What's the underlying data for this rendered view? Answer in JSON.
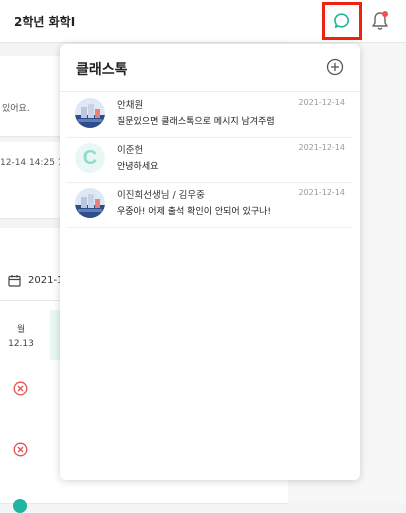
{
  "header": {
    "title": "2학년 화학I"
  },
  "background": {
    "notice_text": "있어요.",
    "timestamp": "12-14 14:25 1",
    "date_range": "2021-1",
    "day_name": "월",
    "day_date": "12.13"
  },
  "chat_popup": {
    "title": "클래스톡",
    "messages": [
      {
        "name": "안채원",
        "time": "2021-12-14",
        "text": "질문있으면 클래스톡으로 메시지 남겨주렴"
      },
      {
        "name": "이준헌",
        "time": "2021-12-14",
        "text": "안녕하세요",
        "avatar_letter": "C"
      },
      {
        "name": "이진희선생님 / 김우중",
        "time": "2021-12-14",
        "text": "우중아! 어제 출석 확인이 안되어 있구나!"
      }
    ]
  },
  "colors": {
    "accent_teal": "#1fb5a0",
    "highlight_red": "#ee2211",
    "absent_red": "#e45050",
    "notification_dot": "#f05050"
  }
}
